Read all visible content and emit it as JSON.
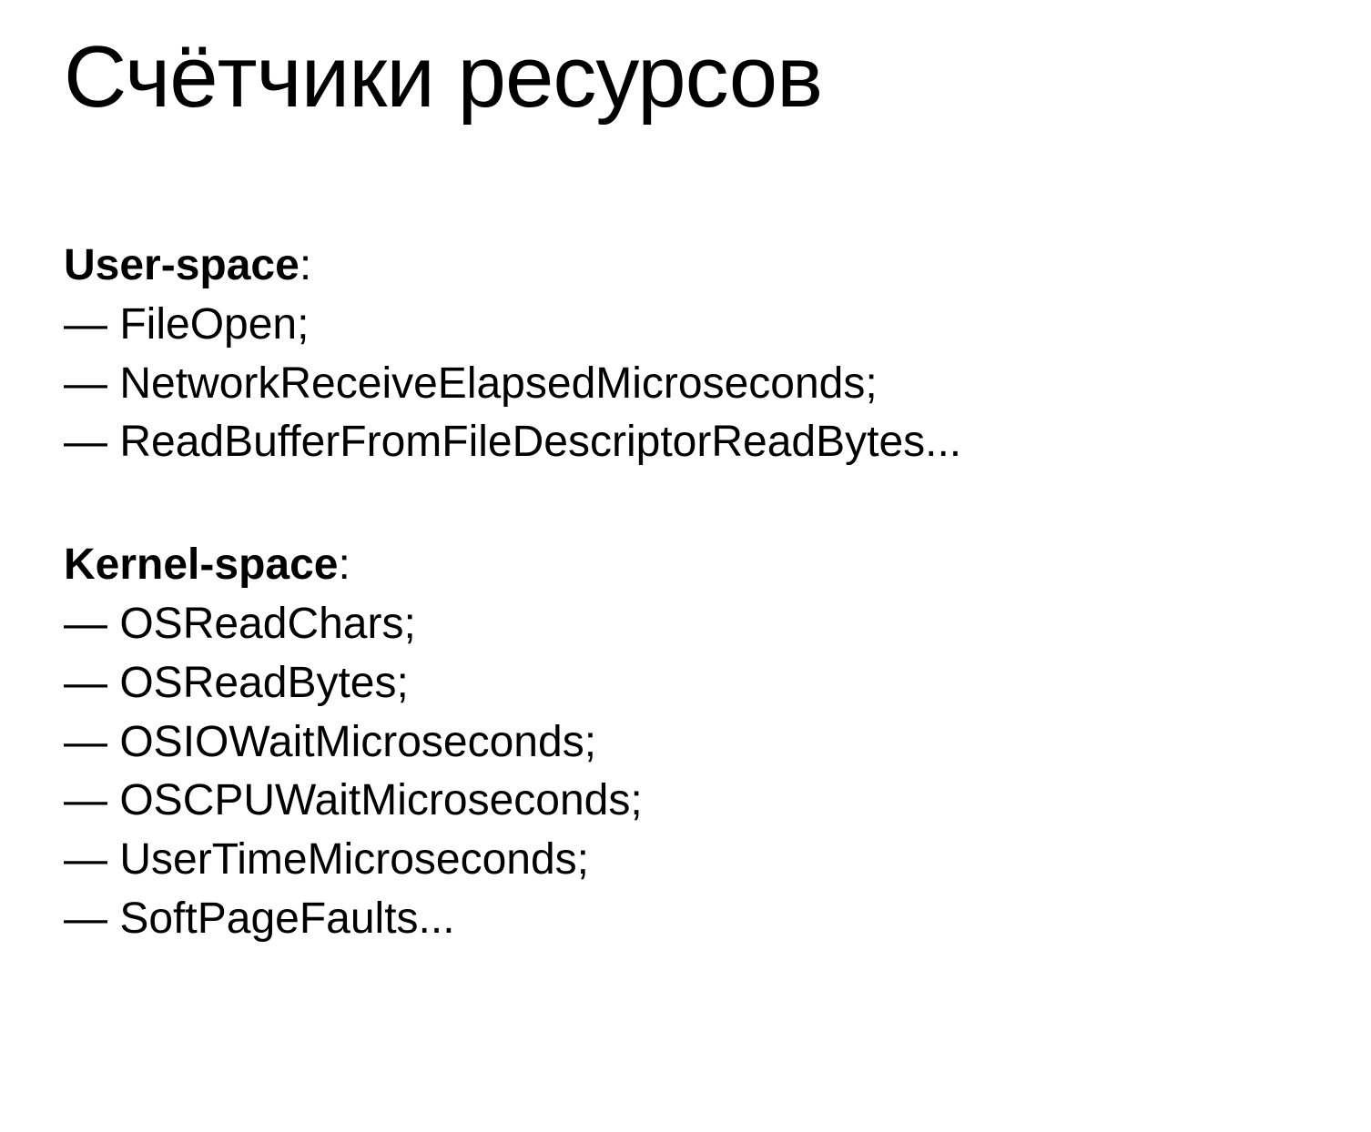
{
  "title": "Счётчики ресурсов",
  "sections": [
    {
      "header": "User-space",
      "items": [
        "FileOpen;",
        "NetworkReceiveElapsedMicroseconds;",
        "ReadBufferFromFileDescriptorReadBytes..."
      ]
    },
    {
      "header": "Kernel-space",
      "items": [
        "OSReadChars;",
        "OSReadBytes;",
        "OSIOWaitMicroseconds;",
        "OSCPUWaitMicroseconds;",
        "UserTimeMicroseconds;",
        "SoftPageFaults..."
      ]
    }
  ]
}
